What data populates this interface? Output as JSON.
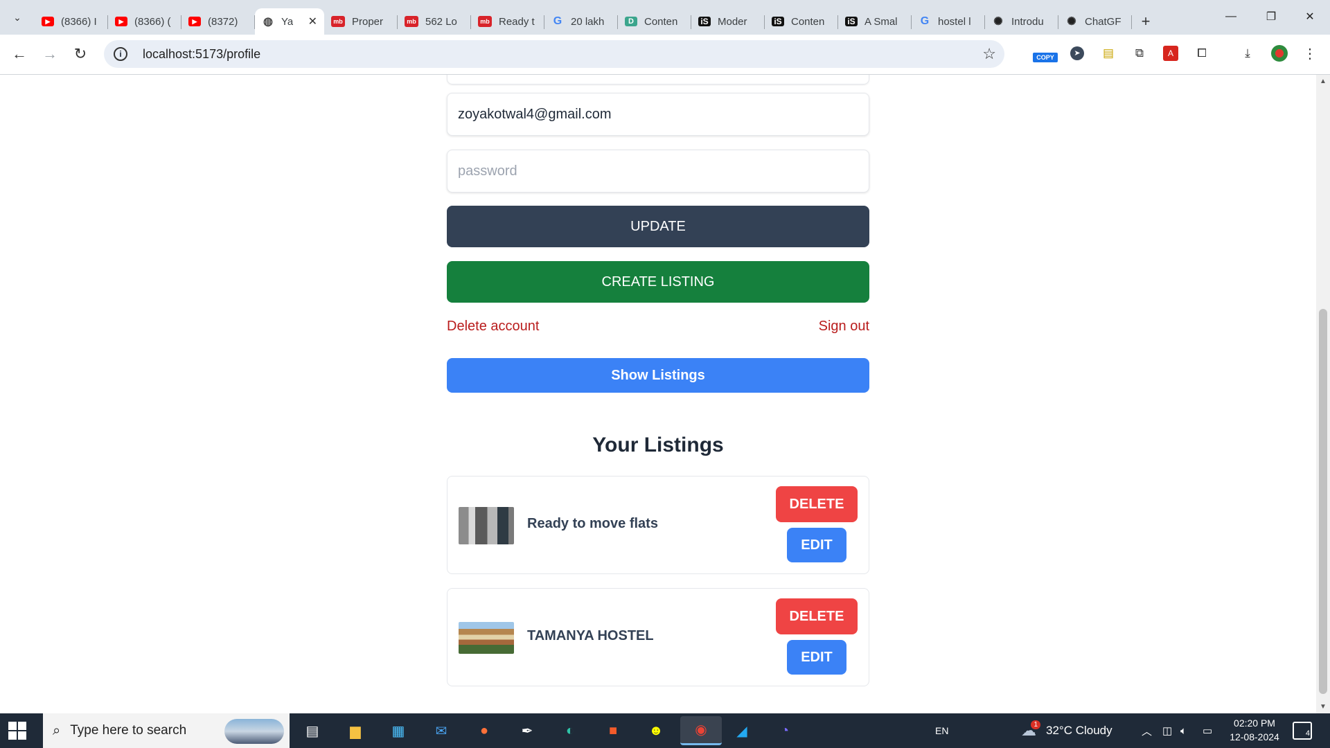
{
  "browser": {
    "tabs": [
      {
        "icon": "youtube-icon",
        "label": "(8366) I"
      },
      {
        "icon": "youtube-icon",
        "label": "(8366) ("
      },
      {
        "icon": "youtube-icon",
        "label": "(8372)"
      },
      {
        "icon": "globe-icon",
        "label": "Ya",
        "active": true
      },
      {
        "icon": "magicbricks-icon",
        "label": "Proper"
      },
      {
        "icon": "magicbricks-icon",
        "label": "562 Lo"
      },
      {
        "icon": "magicbricks-icon",
        "label": "Ready t"
      },
      {
        "icon": "google-icon",
        "label": "20 lakh"
      },
      {
        "icon": "content-icon",
        "label": "Conten"
      },
      {
        "icon": "is-icon",
        "label": "Moder"
      },
      {
        "icon": "is-icon",
        "label": "Conten"
      },
      {
        "icon": "is-icon",
        "label": "A Smal"
      },
      {
        "icon": "google-icon",
        "label": "hostel l"
      },
      {
        "icon": "openai-icon",
        "label": "Introdu"
      },
      {
        "icon": "openai-icon",
        "label": "ChatGF"
      }
    ],
    "url": "localhost:5173/profile",
    "extension_copy_label": "COPY"
  },
  "profile": {
    "email_value": "zoyakotwal4@gmail.com",
    "password_placeholder": "password",
    "update_label": "UPDATE",
    "create_listing_label": "CREATE LISTING",
    "delete_account_label": "Delete account",
    "sign_out_label": "Sign out",
    "show_listings_label": "Show Listings"
  },
  "listings": {
    "heading": "Your Listings",
    "items": [
      {
        "name": "Ready to move flats",
        "delete_label": "DELETE",
        "edit_label": "EDIT"
      },
      {
        "name": "TAMANYA HOSTEL",
        "delete_label": "DELETE",
        "edit_label": "EDIT"
      }
    ]
  },
  "taskbar": {
    "search_placeholder": "Type here to search",
    "language": "EN",
    "weather": "32°C  Cloudy",
    "weather_badge": "1",
    "time": "02:20 PM",
    "date": "12-08-2024",
    "notification_count": "4"
  },
  "colors": {
    "update": "#334155",
    "create_listing": "#15803d",
    "show_listings": "#3b82f6",
    "danger_text": "#b91c1c",
    "delete": "#ef4444",
    "edit": "#3b82f6"
  }
}
